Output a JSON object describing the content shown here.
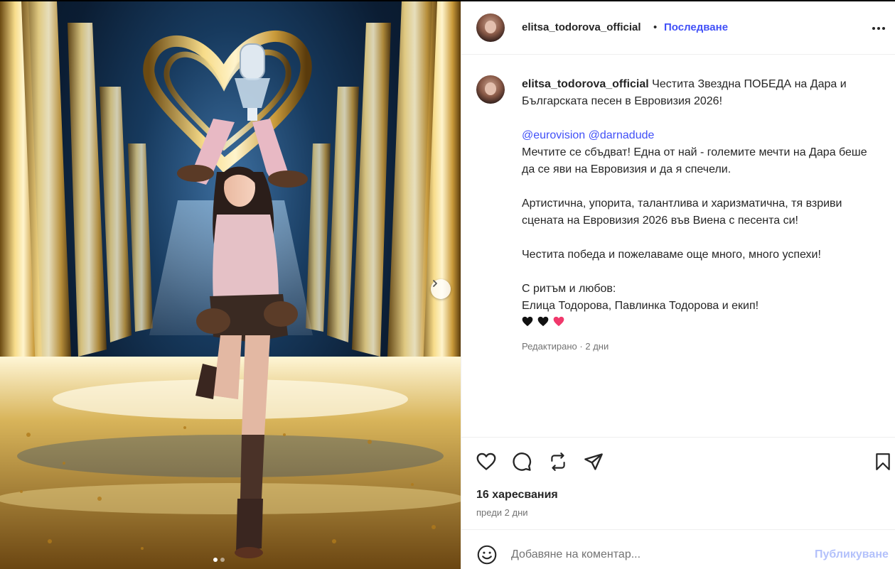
{
  "post": {
    "username": "elitsa_todorova_official",
    "separator": "•",
    "follow_label": "Последване",
    "caption": {
      "username": "elitsa_todorova_official",
      "line1": "Честита Звездна ПОБЕДА на Дара и Българската песен в Евровизия 2026!",
      "mention1": "@eurovision",
      "mention2": "@darnadude",
      "line2": "Мечтите се сбъдват! Една от най - големите мечти на Дара беше да се яви на Евровизия и да я спечели.",
      "line3": "Артистична, упорита, талантлива и харизматична, тя взриви сцената на Евровизия 2026 във Виена с песента си!",
      "line4": "Честита победа и пожелаваме още много, много успехи!",
      "line5": "С ритъм и любов:",
      "line6": "Елица Тодорова, Павлинка Тодорова и екип!"
    },
    "edited_label": "Редактирано",
    "edited_sep": "·",
    "edited_time": "2 дни",
    "likes_text": "16 харесвания",
    "time_ago": "преди 2 дни",
    "comment_placeholder": "Добавяне на коментар...",
    "publish_label": "Публикуване"
  },
  "icons": {
    "like": "heart-icon",
    "comment": "comment-icon",
    "repost": "repost-icon",
    "share": "share-icon",
    "save": "bookmark-icon",
    "emoji": "emoji-icon",
    "more": "more-options-icon",
    "next": "chevron-right-icon"
  },
  "colors": {
    "link": "#4150f7",
    "publish_disabled": "#b3c1fb",
    "meta": "#737373",
    "heart_pink": "#f0386b"
  }
}
